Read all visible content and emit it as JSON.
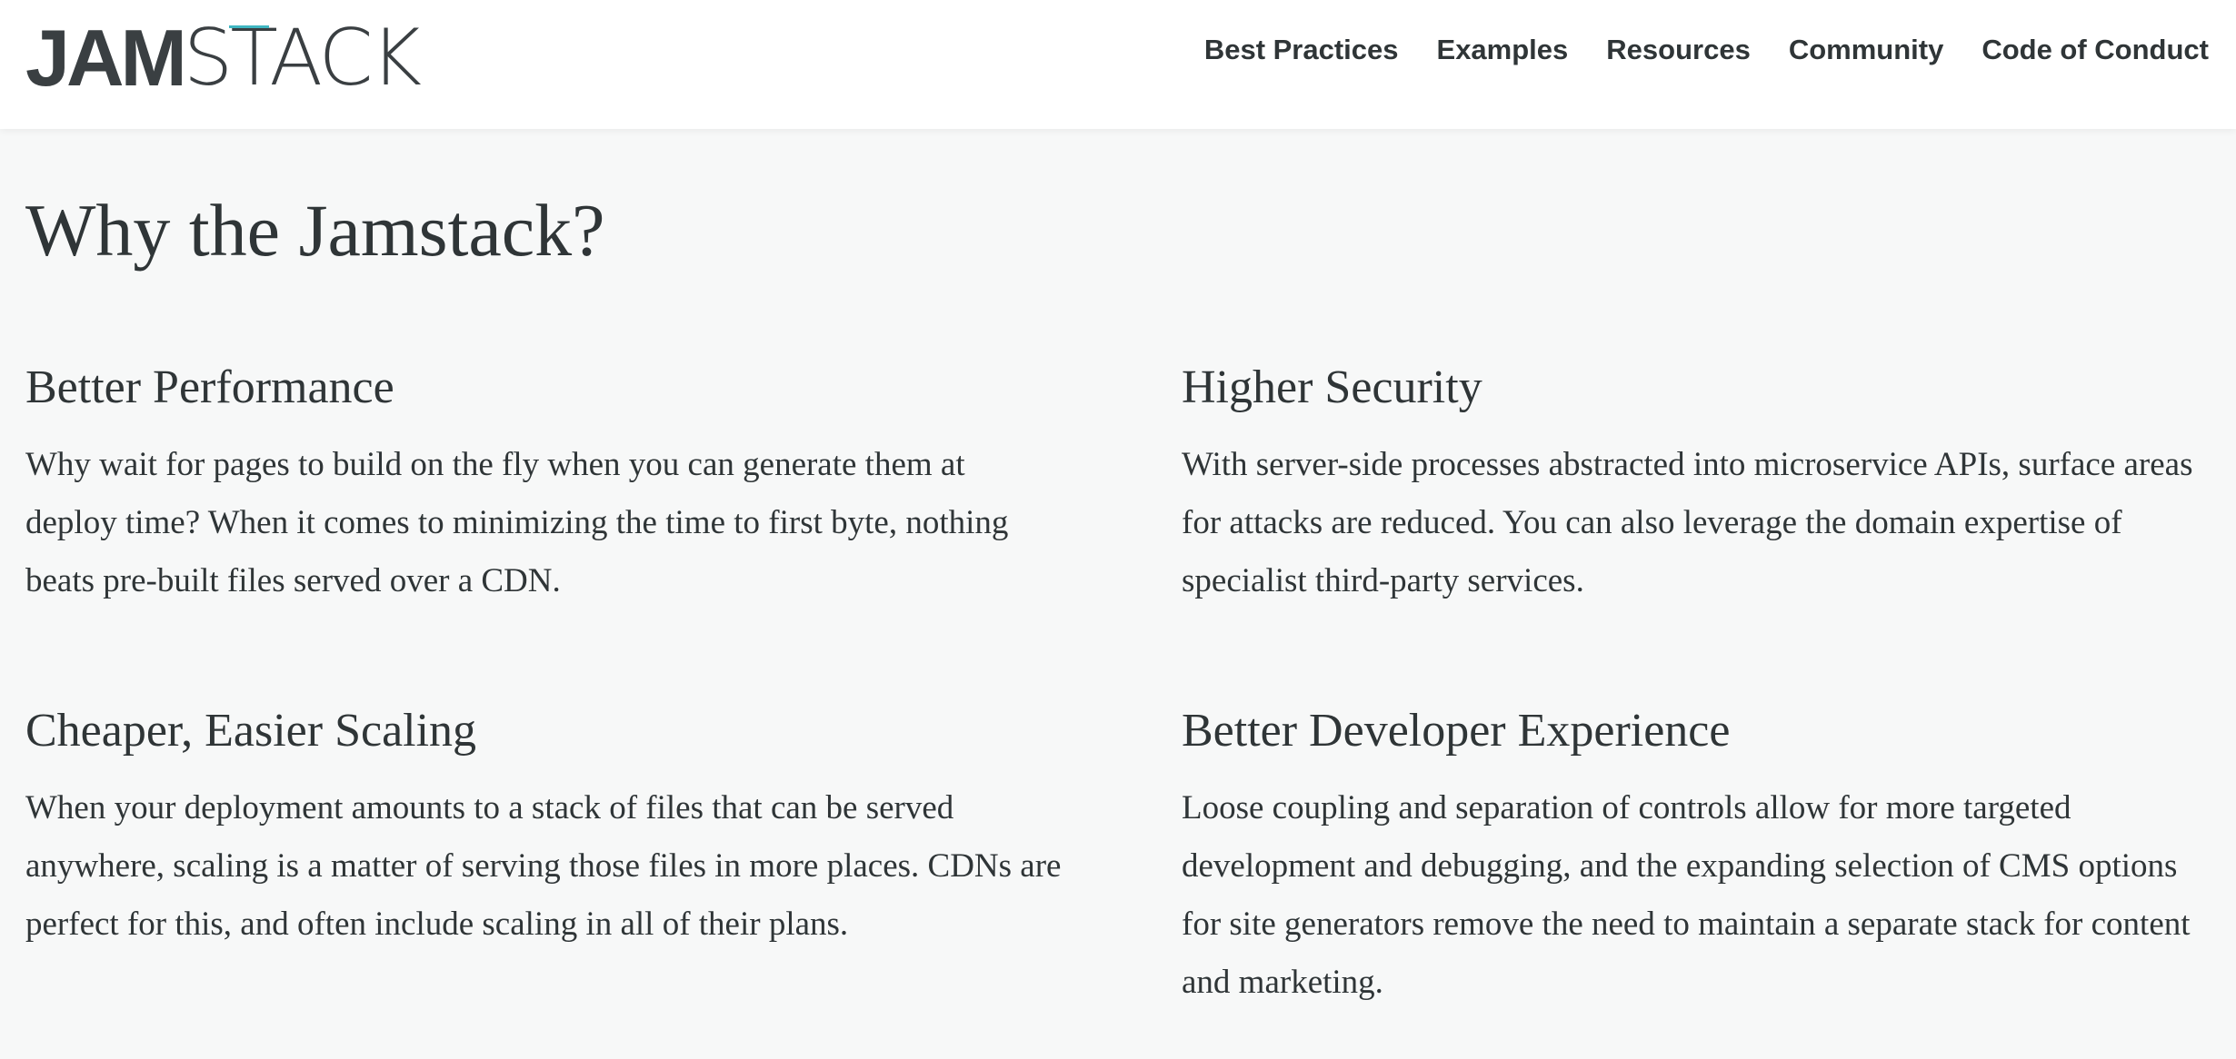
{
  "logo": {
    "part1": "JAM",
    "part2": "STACK",
    "accent_color": "#3fb6c1"
  },
  "nav": {
    "items": [
      {
        "label": "Best Practices"
      },
      {
        "label": "Examples"
      },
      {
        "label": "Resources"
      },
      {
        "label": "Community"
      },
      {
        "label": "Code of Conduct"
      }
    ]
  },
  "main": {
    "title": "Why the Jamstack?",
    "features": [
      {
        "heading": "Better Performance",
        "body": "Why wait for pages to build on the fly when you can generate them at deploy time? When it comes to minimizing the time to first byte, nothing beats pre-built files served over a CDN."
      },
      {
        "heading": "Higher Security",
        "body": "With server-side processes abstracted into microservice APIs, surface areas for attacks are reduced. You can also leverage the domain expertise of specialist third-party services."
      },
      {
        "heading": "Cheaper, Easier Scaling",
        "body": "When your deployment amounts to a stack of files that can be served anywhere, scaling is a matter of serving those files in more places. CDNs are perfect for this, and often include scaling in all of their plans."
      },
      {
        "heading": "Better Developer Experience",
        "body": "Loose coupling and separation of controls allow for more targeted development and debugging, and the expanding selection of CMS options for site generators remove the need to maintain a separate stack for content and marketing."
      }
    ]
  }
}
